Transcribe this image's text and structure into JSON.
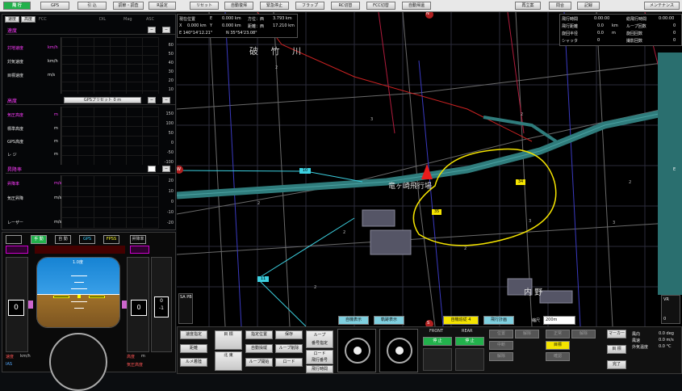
{
  "colors": {
    "accent_green": "#22b14c",
    "magenta": "#ff3cff",
    "cyan": "#7fd0ff",
    "yellow": "#f5e400",
    "map_bg": "#000000",
    "river": "#3b8f8f"
  },
  "topbar": {
    "left_buttons": [
      "飛 行",
      "GPS",
      "引 込",
      "調節・調査",
      "R設定"
    ],
    "mid_buttons": [
      "リセット",
      "自動復帰",
      "緊急停止",
      "フラップ",
      "RC切替",
      "FCC切替",
      "自動帰還"
    ],
    "right_buttons": [
      "再立案",
      "問合",
      "記録"
    ],
    "maintenance": "メンテナンス"
  },
  "left": {
    "tabs": [
      "速度",
      "高度",
      "FCC"
    ],
    "tab_extra": [
      "DIL",
      "Mag",
      "ASC"
    ],
    "speed": {
      "title": "速度",
      "rows": [
        {
          "label": "対地速度",
          "unit": "km/h"
        },
        {
          "label": "対気速度",
          "unit": "km/h"
        },
        {
          "label": "目標速度",
          "unit": "m/s"
        }
      ],
      "scale": [
        "60",
        "50",
        "40",
        "30",
        "20",
        "10",
        "0"
      ]
    },
    "altitude": {
      "title": "高度",
      "preset": "GPSプリセット 0 m",
      "rows": [
        {
          "label": "気圧高度",
          "unit": "m"
        },
        {
          "label": "標準高度",
          "unit": "m"
        },
        {
          "label": "GPS高度",
          "unit": "m"
        },
        {
          "label": "レ ジ",
          "unit": "m"
        }
      ],
      "scale": [
        "150",
        "100",
        "50",
        "0",
        "-50",
        "-100",
        "-150"
      ]
    },
    "vspeed": {
      "title": "昇降率",
      "rows": [
        {
          "label": "昇降率",
          "unit": "m/s"
        },
        {
          "label": "気圧昇降",
          "unit": "m/s"
        },
        {
          "label": "レーザー",
          "unit": "m/s"
        }
      ],
      "scale": [
        "20",
        "10",
        "0",
        "-10",
        "-20"
      ]
    }
  },
  "pfd": {
    "mode_labels": [
      "手 動",
      "自 動",
      "GPS",
      "FPSS"
    ],
    "head_label": "昇降率",
    "heading_value": "1.0度",
    "left_value": "0",
    "right_value": "0",
    "right_sub": "0\n-1",
    "bottom_left": "速度",
    "bottom_left_unit": "km/h",
    "bottom_right": "高度",
    "bottom_right_unit": "m",
    "ias_label": "IAS",
    "alt_label": "気圧高度",
    "left_scale": [
      "50",
      "40",
      "30",
      "20",
      "10",
      "0",
      "-10"
    ],
    "right_scale": [
      "200",
      "150",
      "100",
      "50",
      "0",
      "-50",
      "-100",
      "-150"
    ]
  },
  "map": {
    "info_left": {
      "rows": [
        {
          "a": "現在位置",
          "b": "E",
          "c": "0.000 km",
          "d": "方位：西",
          "e": "3.793 km"
        },
        {
          "a": "X",
          "b": "0.000 km",
          "c": "Y",
          "d": "0.000 km",
          "e": "距離：西",
          "f": "17.210 km"
        },
        {
          "a": "E 140°14'12.21\"",
          "b": "N 35°54'23.08\""
        }
      ]
    },
    "info_right": {
      "rows": [
        {
          "a": "飛行時間",
          "b": "0:00:00",
          "c": "総飛行時間",
          "d": "0:00:00"
        },
        {
          "a": "飛行距離",
          "b": "0.0",
          "c": "km",
          "d": "ループ回数",
          "e": "0"
        },
        {
          "a": "旋回半径",
          "b": "0.0",
          "c": "m",
          "d": "旋回回数",
          "e": "0"
        },
        {
          "a": "シャッタ",
          "b": "0",
          "c": "撮影回数",
          "d": "0"
        }
      ]
    },
    "place_river": "破 竹 川",
    "place_airfield": "竜ヶ崎飛行場",
    "place_town": "内 野",
    "compass": {
      "n": "N",
      "s": "S",
      "e": "E",
      "w": "W"
    },
    "waypoint_labels": [
      "10",
      "11",
      "34",
      "35"
    ],
    "bottom_buttons": [
      "自機表示",
      "軌跡表示"
    ],
    "zoom_label": "縮尺",
    "zoom_value": "200m",
    "mode_btns": [
      "自機追従 4",
      "飛行計画"
    ],
    "left_gauge_label": "SA PB",
    "right_gauge_label": "VR",
    "right_gauge_value": "0",
    "scale_numbers": [
      "2",
      "3",
      "2",
      "2",
      "2",
      "3",
      "2",
      "3",
      "2",
      "2"
    ]
  },
  "bottom": {
    "col1": [
      "速度指定",
      "距離",
      "ルメ着陸"
    ],
    "col2": [
      "目 標",
      "北 東"
    ],
    "col3": [
      "指定位置",
      "自動操縦",
      "ループ開始"
    ],
    "col4": [
      "保存",
      "ループ削除",
      "ロード"
    ],
    "col5": [
      "ループ\n番号指定",
      "ロード\n飛行番号",
      "飛行時間"
    ],
    "front_label": "FRONT",
    "rear_label": "REAR",
    "front_val": "停 止",
    "rear_val": "停 止",
    "grid_btns": [
      "位置",
      "解除",
      "正常",
      "解除",
      "中断",
      "目標",
      "解除",
      "確認"
    ],
    "side_btns": [
      "マーカー",
      "目 標",
      "完了"
    ],
    "status": [
      {
        "label": "風向",
        "value": "0.0 deg"
      },
      {
        "label": "風速",
        "value": "0.0 m/s"
      },
      {
        "label": "外気温度",
        "value": "0.0 °C"
      }
    ]
  }
}
